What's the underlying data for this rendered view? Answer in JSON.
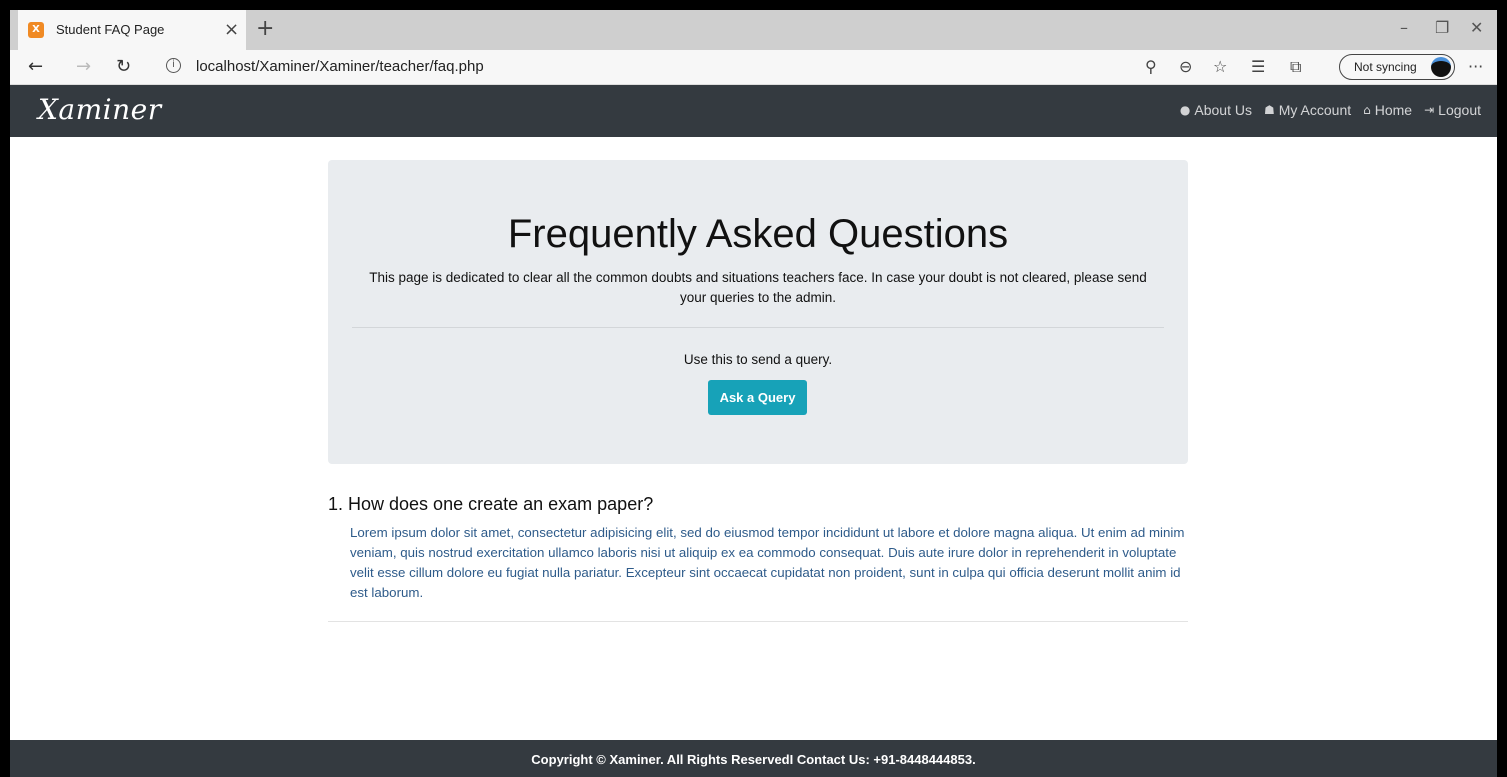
{
  "browser": {
    "tab_title": "Student FAQ Page",
    "favicon_glyph": "X",
    "tab_close": "×",
    "new_tab": "+",
    "url": "localhost/Xaminer/Xaminer/teacher/faq.php",
    "sync_label": "Not syncing",
    "window_controls": {
      "minimize": "–",
      "restore": "❐",
      "close": "✕"
    },
    "nav": {
      "back": "←",
      "forward": "→",
      "refresh": "↻",
      "info": "i"
    },
    "tools": {
      "zoom_in": "⚲",
      "zoom_out": "⊖",
      "favorite": "☆",
      "favorites": "☰",
      "collections": "⧉",
      "more": "···"
    }
  },
  "navbar": {
    "brand": "Xaminer",
    "links": [
      {
        "label": "About Us",
        "icon": "info-circle-icon",
        "glyph": "●"
      },
      {
        "label": "My Account",
        "icon": "user-icon",
        "glyph": "☗"
      },
      {
        "label": "Home",
        "icon": "home-icon",
        "glyph": "⌂"
      },
      {
        "label": "Logout",
        "icon": "sign-out-icon",
        "glyph": "⇥"
      }
    ]
  },
  "jumbotron": {
    "title": "Frequently Asked Questions",
    "lead": "This page is dedicated to clear all the common doubts and situations teachers face. In case your doubt is not cleared, please send your queries to the admin.",
    "query_text": "Use this to send a query.",
    "button_label": "Ask a Query"
  },
  "faq": [
    {
      "question": "1. How does one create an exam paper?",
      "answer": "Lorem ipsum dolor sit amet, consectetur adipisicing elit, sed do eiusmod tempor incididunt ut labore et dolore magna aliqua. Ut enim ad minim veniam, quis nostrud exercitation ullamco laboris nisi ut aliquip ex ea commodo consequat. Duis aute irure dolor in reprehenderit in voluptate velit esse cillum dolore eu fugiat nulla pariatur. Excepteur sint occaecat cupidatat non proident, sunt in culpa qui officia deserunt mollit anim id est laborum."
    }
  ],
  "footer": {
    "text": "Copyright © Xaminer. All Rights ReservedI Contact Us: +91-8448444853."
  },
  "colors": {
    "navbar_bg": "#343a40",
    "jumbotron_bg": "#e9ecef",
    "button_bg": "#17a2b8",
    "answer_text": "#2e5b8a"
  }
}
